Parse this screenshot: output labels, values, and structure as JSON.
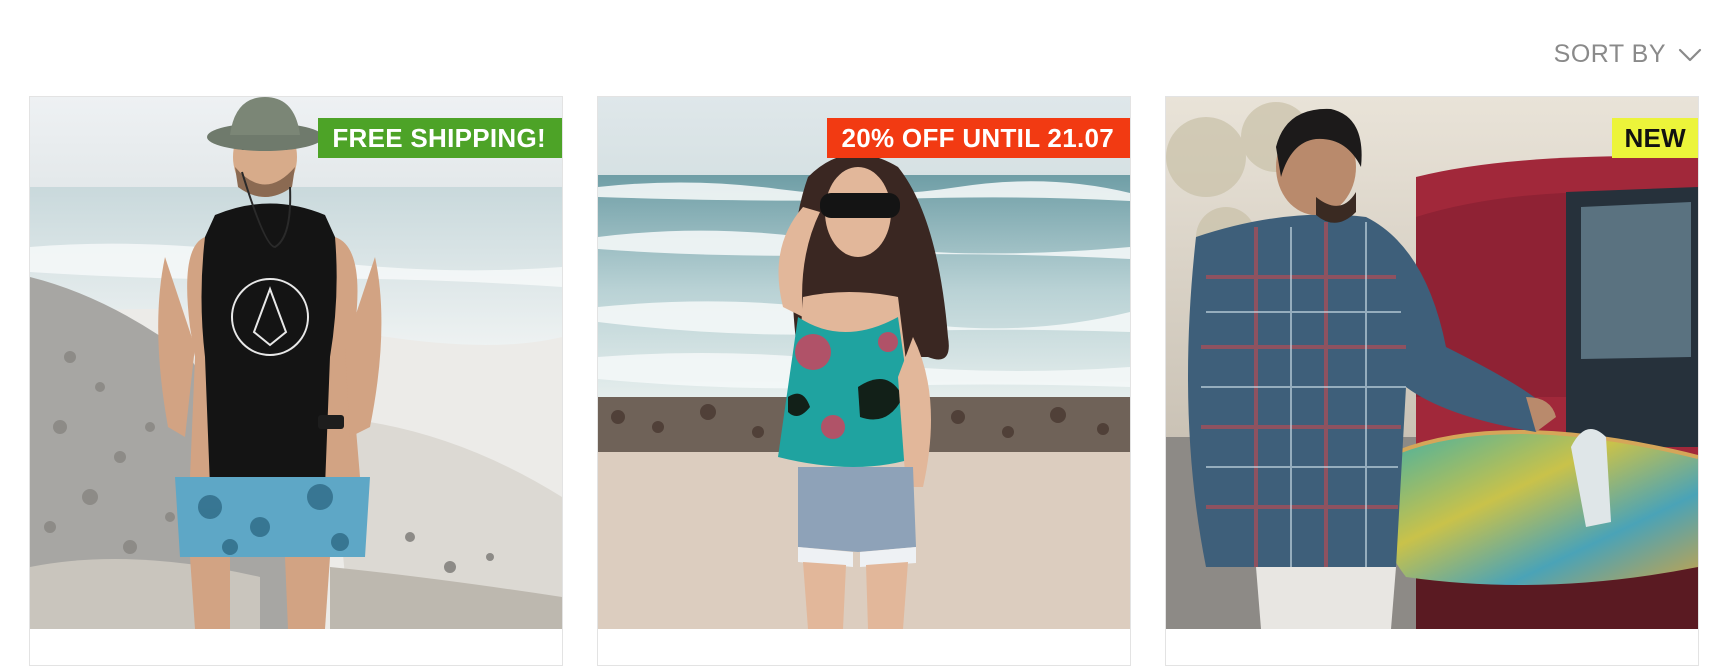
{
  "toolbar": {
    "sort_label": "SORT BY",
    "sort_icon": "chevron-down-icon"
  },
  "colors": {
    "badge_free_shipping": "#4da327",
    "badge_discount": "#f23a12",
    "badge_new": "#ecf43a",
    "sort_text": "#8a8a8a"
  },
  "products": [
    {
      "badge": "FREE SHIPPING!"
    },
    {
      "badge": "20% OFF UNTIL 21.07"
    },
    {
      "badge": "NEW"
    }
  ]
}
